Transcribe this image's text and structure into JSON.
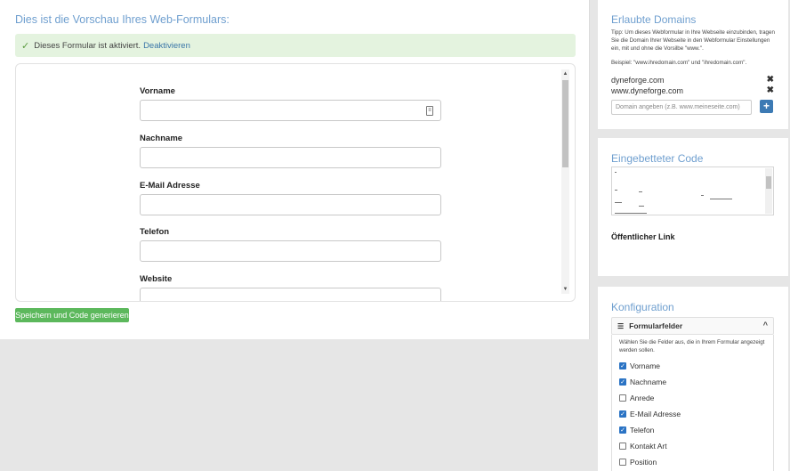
{
  "preview": {
    "title": "Dies ist die Vorschau Ihres Web-Formulars:",
    "alert_text": "Dieses Formular ist aktiviert.",
    "alert_link": "Deaktivieren",
    "fields": [
      {
        "label": "Vorname"
      },
      {
        "label": "Nachname"
      },
      {
        "label": "E-Mail Adresse"
      },
      {
        "label": "Telefon"
      },
      {
        "label": "Website"
      }
    ],
    "save_button": "Speichern und Code generieren"
  },
  "domains": {
    "title": "Erlaubte Domains",
    "tip": "Tipp: Um dieses Webformular in Ihre Webseite einzubinden, tragen Sie die Domain Ihrer Webseite in den Webformular Einstellungen ein, mit und ohne die Vorsilbe \"www.\".",
    "example": "Beispiel: \"www.ihredomain.com\" und \"ihredomain.com\".",
    "items": [
      "dyneforge.com",
      "www.dyneforge.com"
    ],
    "input_placeholder": "Domain angeben (z.B. www.meineseite.com)",
    "add_label": "+"
  },
  "embedded": {
    "title": "Eingebetteter Code",
    "public_link_label": "Öffentlicher Link"
  },
  "config": {
    "title": "Konfiguration",
    "section_label": "Formularfelder",
    "description": "Wählen Sie die Felder aus, die in Ihrem Formular angezeigt werden sollen.",
    "options": [
      {
        "label": "Vorname",
        "checked": true
      },
      {
        "label": "Nachname",
        "checked": true
      },
      {
        "label": "Anrede",
        "checked": false
      },
      {
        "label": "E-Mail Adresse",
        "checked": true
      },
      {
        "label": "Telefon",
        "checked": true
      },
      {
        "label": "Kontakt Art",
        "checked": false
      },
      {
        "label": "Position",
        "checked": false
      }
    ]
  },
  "colors": {
    "accent": "#6f9fcf",
    "success_bg": "#e4f3df",
    "save_button": "#5cb85c",
    "add_button": "#3c7ab4",
    "checkbox": "#2a73c4"
  }
}
